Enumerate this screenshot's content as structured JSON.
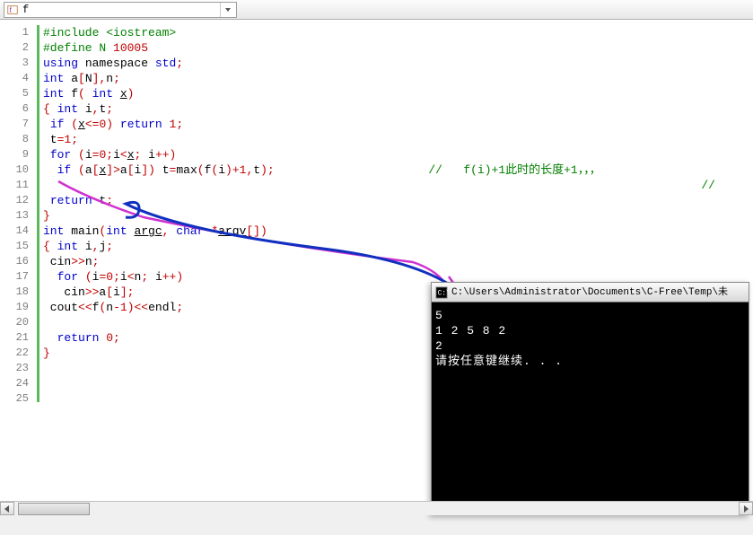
{
  "toolbar": {
    "function_name": "f"
  },
  "code": {
    "lines": [
      [
        [
          "preproc",
          "#include <iostream>"
        ]
      ],
      [
        [
          "preproc",
          "#define N "
        ],
        [
          "num",
          "10005"
        ]
      ],
      [
        [
          "kw",
          "using"
        ],
        [
          "id",
          " namespace "
        ],
        [
          "type",
          "std"
        ],
        [
          "op",
          ";"
        ]
      ],
      [
        [
          "kw",
          "int"
        ],
        [
          "id",
          " a"
        ],
        [
          "op",
          "["
        ],
        [
          "id",
          "N"
        ],
        [
          "op",
          "],"
        ],
        [
          "id",
          "n"
        ],
        [
          "op",
          ";"
        ]
      ],
      [
        [
          "kw",
          "int"
        ],
        [
          "id",
          " f"
        ],
        [
          "op",
          "( "
        ],
        [
          "kw",
          "int"
        ],
        [
          "id",
          " "
        ],
        [
          "ul",
          "x"
        ],
        [
          "op",
          ")"
        ]
      ],
      [
        [
          "op",
          "{ "
        ],
        [
          "kw",
          "int"
        ],
        [
          "id",
          " i"
        ],
        [
          "op",
          ","
        ],
        [
          "id",
          "t"
        ],
        [
          "op",
          ";"
        ]
      ],
      [
        [
          "id",
          " "
        ],
        [
          "kw",
          "if"
        ],
        [
          "id",
          " "
        ],
        [
          "op",
          "("
        ],
        [
          "ul",
          "x"
        ],
        [
          "op",
          "<="
        ],
        [
          "num",
          "0"
        ],
        [
          "op",
          ") "
        ],
        [
          "kw",
          "return"
        ],
        [
          "id",
          " "
        ],
        [
          "num",
          "1"
        ],
        [
          "op",
          ";"
        ]
      ],
      [
        [
          "id",
          " t"
        ],
        [
          "op",
          "="
        ],
        [
          "num",
          "1"
        ],
        [
          "op",
          ";"
        ]
      ],
      [
        [
          "id",
          " "
        ],
        [
          "kw",
          "for"
        ],
        [
          "id",
          " "
        ],
        [
          "op",
          "("
        ],
        [
          "id",
          "i"
        ],
        [
          "op",
          "="
        ],
        [
          "num",
          "0"
        ],
        [
          "op",
          ";"
        ],
        [
          "id",
          "i"
        ],
        [
          "op",
          "<"
        ],
        [
          "ul",
          "x"
        ],
        [
          "op",
          "; "
        ],
        [
          "id",
          "i"
        ],
        [
          "op",
          "++)"
        ]
      ],
      [
        [
          "id",
          "  "
        ],
        [
          "kw",
          "if"
        ],
        [
          "id",
          " "
        ],
        [
          "op",
          "("
        ],
        [
          "id",
          "a"
        ],
        [
          "op",
          "["
        ],
        [
          "ul",
          "x"
        ],
        [
          "op",
          "]>"
        ],
        [
          "id",
          "a"
        ],
        [
          "op",
          "["
        ],
        [
          "id",
          "i"
        ],
        [
          "op",
          "]) "
        ],
        [
          "id",
          "t"
        ],
        [
          "op",
          "="
        ],
        [
          "id",
          "max"
        ],
        [
          "op",
          "("
        ],
        [
          "id",
          "f"
        ],
        [
          "op",
          "("
        ],
        [
          "id",
          "i"
        ],
        [
          "op",
          ")+"
        ],
        [
          "num",
          "1"
        ],
        [
          "op",
          ","
        ],
        [
          "id",
          "t"
        ],
        [
          "op",
          ");"
        ]
      ],
      [
        [
          "id",
          ""
        ]
      ],
      [
        [
          "id",
          " "
        ],
        [
          "kw",
          "return"
        ],
        [
          "id",
          " t"
        ],
        [
          "op",
          "; "
        ]
      ],
      [
        [
          "op",
          "}"
        ]
      ],
      [
        [
          "kw",
          "int"
        ],
        [
          "id",
          " main"
        ],
        [
          "op",
          "("
        ],
        [
          "kw",
          "int"
        ],
        [
          "id",
          " "
        ],
        [
          "ul",
          "argc"
        ],
        [
          "op",
          ", "
        ],
        [
          "kw",
          "char"
        ],
        [
          "id",
          " "
        ],
        [
          "op",
          "*"
        ],
        [
          "ul",
          "argv"
        ],
        [
          "op",
          "[])"
        ]
      ],
      [
        [
          "op",
          "{ "
        ],
        [
          "kw",
          "int"
        ],
        [
          "id",
          " i"
        ],
        [
          "op",
          ","
        ],
        [
          "id",
          "j"
        ],
        [
          "op",
          ";"
        ]
      ],
      [
        [
          "id",
          " cin"
        ],
        [
          "op",
          ">>"
        ],
        [
          "id",
          "n"
        ],
        [
          "op",
          ";"
        ]
      ],
      [
        [
          "id",
          "  "
        ],
        [
          "kw",
          "for"
        ],
        [
          "id",
          " "
        ],
        [
          "op",
          "("
        ],
        [
          "id",
          "i"
        ],
        [
          "op",
          "="
        ],
        [
          "num",
          "0"
        ],
        [
          "op",
          ";"
        ],
        [
          "id",
          "i"
        ],
        [
          "op",
          "<"
        ],
        [
          "id",
          "n"
        ],
        [
          "op",
          "; "
        ],
        [
          "id",
          "i"
        ],
        [
          "op",
          "++)"
        ]
      ],
      [
        [
          "id",
          "   cin"
        ],
        [
          "op",
          ">>"
        ],
        [
          "id",
          "a"
        ],
        [
          "op",
          "["
        ],
        [
          "id",
          "i"
        ],
        [
          "op",
          "];"
        ]
      ],
      [
        [
          "id",
          " cout"
        ],
        [
          "op",
          "<<"
        ],
        [
          "id",
          "f"
        ],
        [
          "op",
          "("
        ],
        [
          "id",
          "n"
        ],
        [
          "op",
          "-"
        ],
        [
          "num",
          "1"
        ],
        [
          "op",
          ")<<"
        ],
        [
          "id",
          "endl"
        ],
        [
          "op",
          ";"
        ]
      ],
      [
        [
          "id",
          ""
        ]
      ],
      [
        [
          "id",
          "  "
        ],
        [
          "kw",
          "return"
        ],
        [
          "id",
          " "
        ],
        [
          "num",
          "0"
        ],
        [
          "op",
          ";"
        ]
      ],
      [
        [
          "op",
          "}"
        ]
      ],
      [
        [
          "id",
          ""
        ]
      ],
      [
        [
          "id",
          ""
        ]
      ],
      [
        [
          "id",
          ""
        ]
      ]
    ],
    "inline_comment": "//   f(i)+1此时的长度+1，，，",
    "inline_comment2": "//"
  },
  "terminal": {
    "title": "C:\\Users\\Administrator\\Documents\\C-Free\\Temp\\未",
    "line1": "5",
    "line2": "1 2 5 8 2",
    "line3": "2",
    "line4": "请按任意键继续. . ."
  },
  "annotations": {
    "a_i": "a[i]",
    "a_x": "a[x]"
  }
}
